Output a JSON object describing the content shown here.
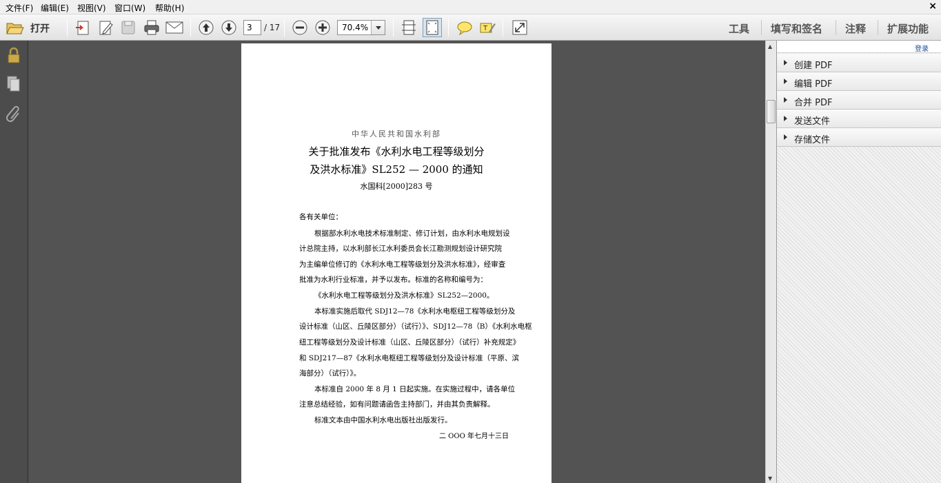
{
  "menu": [
    "文件(F)",
    "编辑(E)",
    "视图(V)",
    "窗口(W)",
    "帮助(H)"
  ],
  "window_close": "×",
  "toolbar": {
    "open_label": "打开",
    "page_current": "3",
    "page_total": "/ 17",
    "zoom": "70.4%",
    "links": [
      "工具",
      "填写和签名",
      "注释",
      "扩展功能"
    ]
  },
  "icons": [
    "open-folder-icon",
    "create-pdf-icon",
    "edit-icon",
    "save-icon",
    "print-icon",
    "email-icon",
    "previous-page-icon",
    "next-page-icon",
    "zoom-out-icon",
    "zoom-in-icon",
    "fit-page-icon",
    "fit-width-icon",
    "comment-icon",
    "highlight-icon",
    "fullscreen-icon",
    "lock-icon",
    "pages-icon",
    "attachment-icon"
  ],
  "document": {
    "pub_org": "中华人民共和国水利部",
    "title_line1": "关于批准发布《水利水电工程等级划分",
    "title_line2": "及洪水标准》SL252 — 2000 的通知",
    "doc_number": "水国科[2000]283 号",
    "body": [
      {
        "text": "各有关单位：",
        "indent": false
      },
      {
        "text": "根据部水利水电技术标准制定、修订计划，由水利水电规划设",
        "indent": true
      },
      {
        "text": "计总院主持，以水利部长江水利委员会长江勘测规划设计研究院",
        "indent": false
      },
      {
        "text": "为主编单位修订的《水利水电工程等级划分及洪水标准》，经审查",
        "indent": false
      },
      {
        "text": "批准为水利行业标准，并予以发布。标准的名称和编号为：",
        "indent": false
      },
      {
        "text": "《水利水电工程等级划分及洪水标准》SL252—2000。",
        "indent": true
      },
      {
        "text": "本标准实施后取代 SDJ12—78《水利水电枢纽工程等级划分及",
        "indent": true
      },
      {
        "text": "设计标准（山区、丘陵区部分）（试行）》、SDJ12—78（B）《水利水电枢",
        "indent": false
      },
      {
        "text": "纽工程等级划分及设计标准（山区、丘陵区部分）（试行）补充规定》",
        "indent": false
      },
      {
        "text": "和 SDJ217—87《水利水电枢纽工程等级划分及设计标准（平原、滨",
        "indent": false
      },
      {
        "text": "海部分）（试行）》。",
        "indent": false
      },
      {
        "text": "本标准自 2000 年 8 月 1 日起实施。在实施过程中，请各单位",
        "indent": true
      },
      {
        "text": "注意总结经验，如有问题请函告主持部门，并由其负责解释。",
        "indent": false
      },
      {
        "text": "标准文本由中国水利水电出版社出版发行。",
        "indent": true
      }
    ],
    "date": "二 OOO 年七月十三日"
  },
  "right_panel": {
    "login": "登录",
    "items": [
      "创建 PDF",
      "编辑 PDF",
      "合并 PDF",
      "发送文件",
      "存储文件"
    ]
  }
}
